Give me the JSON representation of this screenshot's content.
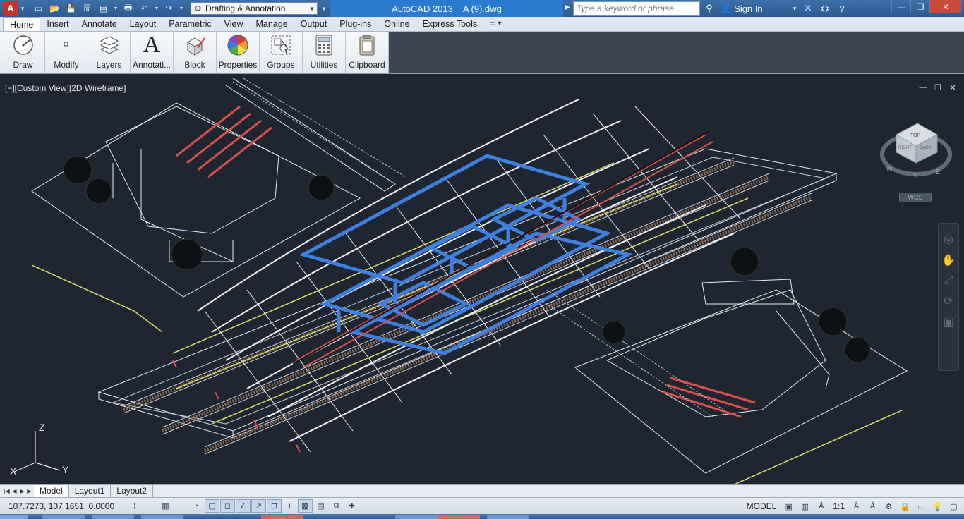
{
  "titlebar": {
    "app_logo": "A",
    "workspace": "Drafting & Annotation",
    "app_name": "AutoCAD 2013",
    "file_name": "A (9).dwg",
    "search_placeholder": "Type a keyword or phrase",
    "sign_in": "Sign In"
  },
  "ribbon": {
    "tabs": [
      "Home",
      "Insert",
      "Annotate",
      "Layout",
      "Parametric",
      "View",
      "Manage",
      "Output",
      "Plug-ins",
      "Online",
      "Express Tools"
    ],
    "active_tab": "Home",
    "panels": [
      "Draw",
      "Modify",
      "Layers",
      "Annotati...",
      "Block",
      "Properties",
      "Groups",
      "Utilities",
      "Clipboard"
    ]
  },
  "viewport": {
    "label": "[−][Custom View][2D Wireframe]",
    "viewcube_faces": [
      "TOP",
      "RIGHT",
      "BACK"
    ],
    "compass": [
      "W",
      "S",
      "E"
    ],
    "wcs": "WCS",
    "ucs_axes": [
      "X",
      "Y",
      "Z"
    ]
  },
  "layout_tabs": [
    "Model",
    "Layout1",
    "Layout2"
  ],
  "status": {
    "coords": "107.7273, 107.1651, 0.0000",
    "model": "MODEL",
    "scale": "1:1"
  },
  "colors": {
    "background": "#1f2631",
    "title_accent": "#2a7bd0",
    "structure_white": "#e6ecf2",
    "structure_blue": "#3f7fe0",
    "structure_red": "#e0504a",
    "structure_yellow": "#d8e06a"
  }
}
